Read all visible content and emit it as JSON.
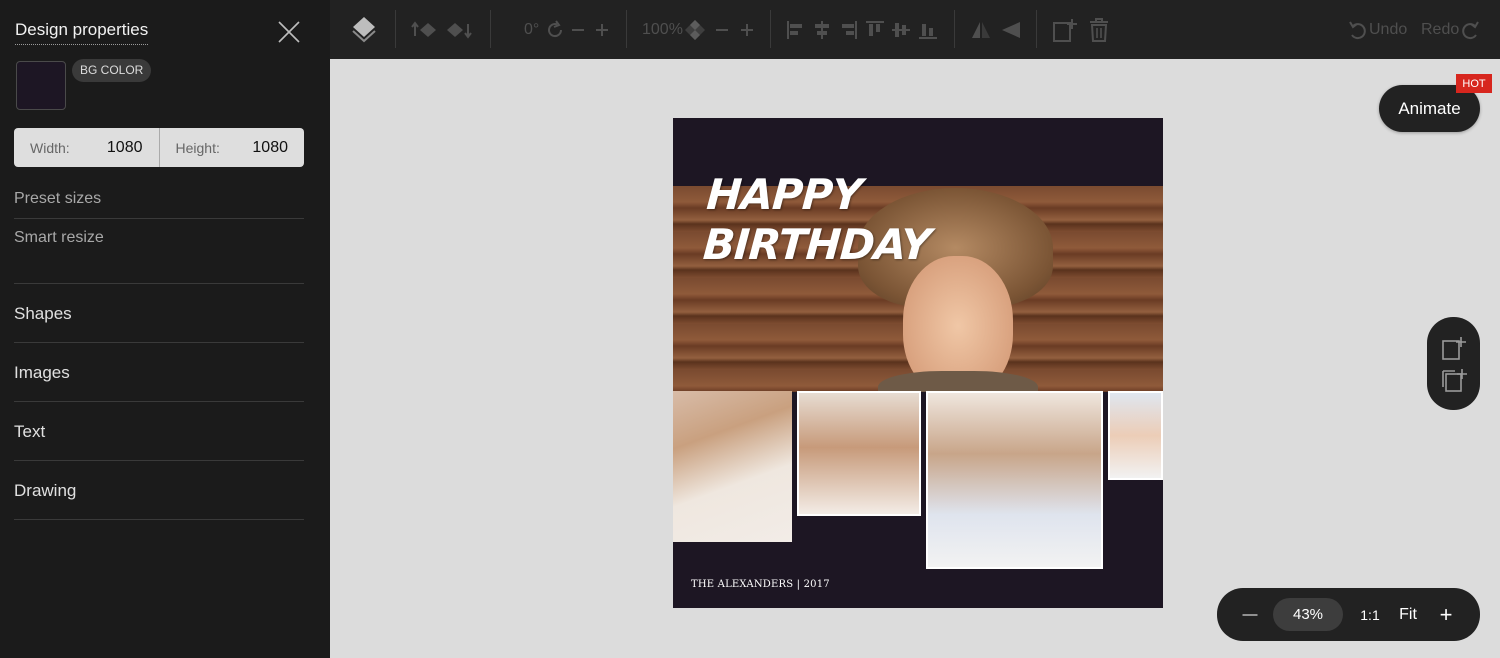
{
  "sidebar": {
    "title": "Design properties",
    "bg_color_label": "BG COLOR",
    "bg_color": "#1d1624",
    "width_label": "Width:",
    "width_value": "1080",
    "height_label": "Height:",
    "height_value": "1080",
    "links": [
      "Preset sizes",
      "Smart resize"
    ],
    "sections": [
      "Shapes",
      "Images",
      "Text",
      "Drawing"
    ]
  },
  "toolbar": {
    "rotation": "0°",
    "opacity": "100%",
    "undo_label": "Undo",
    "redo_label": "Redo"
  },
  "canvas": {
    "headline_line1": "HAPPY",
    "headline_line2": "BIRTHDAY",
    "caption": "THE ALEXANDERS | 2017"
  },
  "right": {
    "animate_label": "Animate",
    "hot_label": "HOT"
  },
  "zoom": {
    "minus": "—",
    "level": "43%",
    "one_to_one": "1:1",
    "fit": "Fit",
    "plus": "+"
  },
  "colors": {
    "sidebar_bg": "#1b1b1b",
    "toolbar_bg": "#222222",
    "workspace_bg": "#dcdcdc",
    "hot_badge": "#d7261e"
  }
}
